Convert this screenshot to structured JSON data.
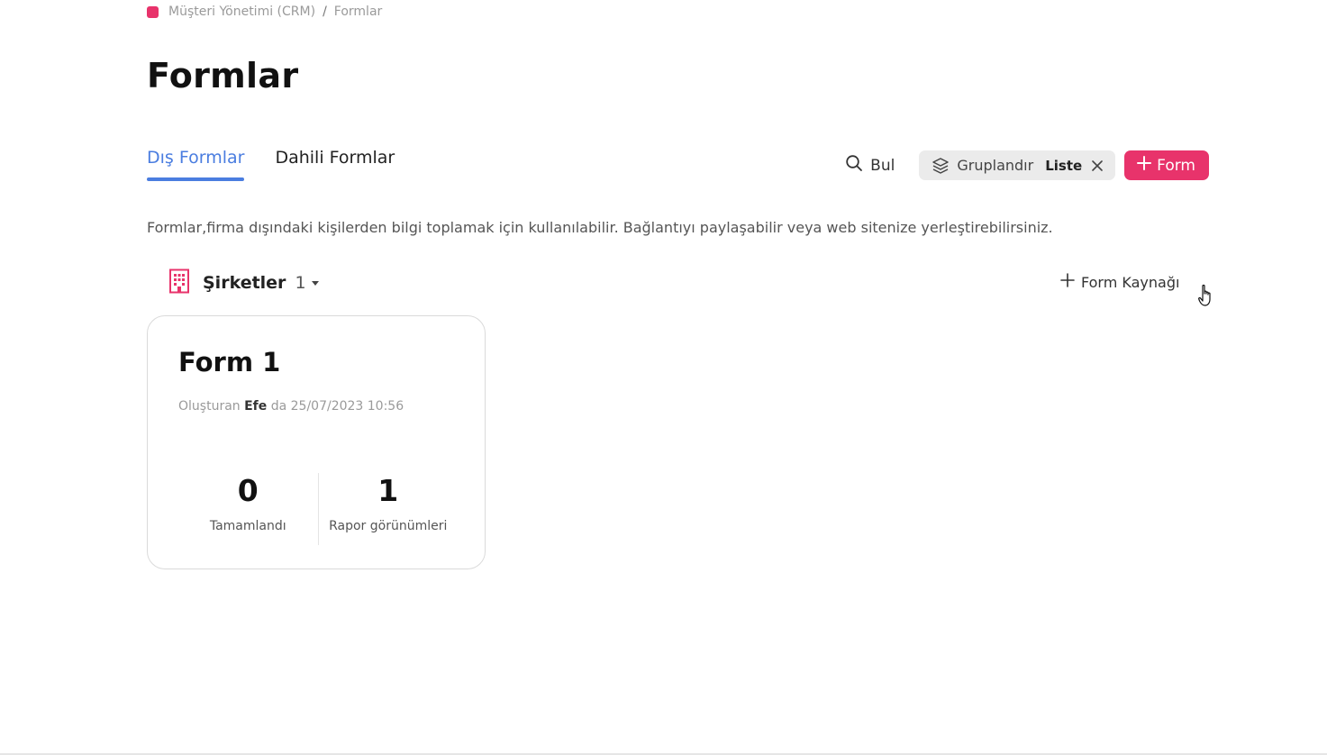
{
  "breadcrumb": {
    "app": "Müşteri Yönetimi (CRM)",
    "separator": "/",
    "current": "Formlar"
  },
  "page": {
    "title": "Formlar"
  },
  "tabs": [
    {
      "label": "Dış Formlar",
      "active": true
    },
    {
      "label": "Dahili Formlar",
      "active": false
    }
  ],
  "toolbar": {
    "find_label": "Bul",
    "group_label": "Gruplandır",
    "group_value": "Liste",
    "add_label": "Form"
  },
  "description": "Formlar,firma dışındaki kişilerden bilgi toplamak için kullanılabilir. Bağlantıyı paylaşabilir veya web sitenize yerleştirebilirsiniz.",
  "group": {
    "title": "Şirketler",
    "count": "1",
    "icon": "building-icon"
  },
  "source_button": {
    "label": "Form Kaynağı"
  },
  "card": {
    "title": "Form 1",
    "meta_prefix": "Oluşturan",
    "author": "Efe",
    "meta_suffix": "da 25/07/2023 10:56",
    "stats": [
      {
        "value": "0",
        "label": "Tamamlandı"
      },
      {
        "value": "1",
        "label": "Rapor görünümleri"
      }
    ]
  },
  "colors": {
    "accent": "#4a7de0",
    "brand": "#e8336b",
    "chip_bg": "#ebebeb"
  }
}
